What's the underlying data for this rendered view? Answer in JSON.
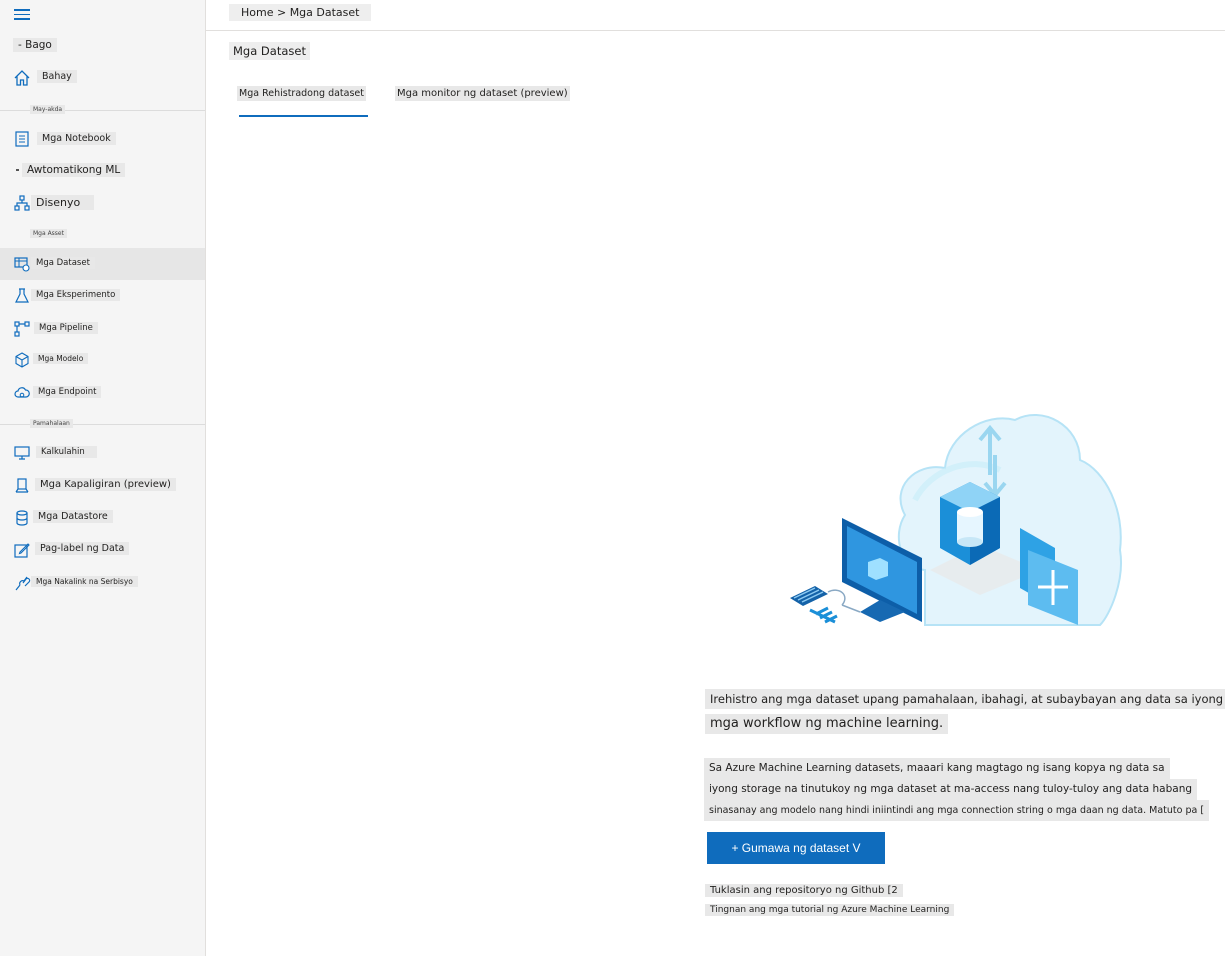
{
  "sidebar": {
    "new_label": "- Bago",
    "home_label": "Bahay",
    "sections": {
      "authoring": "May-akda",
      "assets": "Mga Asset",
      "manage": "Pamahalaan"
    },
    "items": [
      {
        "label": "Mga Notebook",
        "icon": "notebook-icon"
      },
      {
        "label": "Awtomatikong ML",
        "icon": "automl-icon"
      },
      {
        "label": "Disenyo",
        "icon": "designer-icon"
      },
      {
        "label": "Mga Dataset",
        "icon": "dataset-icon"
      },
      {
        "label": "Mga Eksperimento",
        "icon": "flask-icon"
      },
      {
        "label": "Mga Pipeline",
        "icon": "pipeline-icon"
      },
      {
        "label": "Mga Modelo",
        "icon": "cube-icon"
      },
      {
        "label": "Mga Endpoint",
        "icon": "cloud-endpoint-icon"
      },
      {
        "label": "Kalkulahin",
        "icon": "monitor-icon"
      },
      {
        "label": "Mga Kapaligiran (preview)",
        "icon": "environment-icon"
      },
      {
        "label": "Mga Datastore",
        "icon": "database-icon"
      },
      {
        "label": "Pag-label ng Data",
        "icon": "edit-icon"
      },
      {
        "label": "Mga Nakalink na Serbisyo",
        "icon": "link-icon"
      }
    ]
  },
  "header": {
    "breadcrumb": "Home > Mga Dataset",
    "page_title": "Mga Dataset"
  },
  "tabs": [
    {
      "label": "Mga Rehistradong dataset",
      "active": true
    },
    {
      "label": "Mga monitor ng dataset (preview)",
      "active": false
    }
  ],
  "empty_state": {
    "lead_line1": "Irehistro ang mga dataset upang pamahalaan, ibahagi, at subaybayan ang data sa iyong",
    "lead_line2": "mga workflow ng machine learning.",
    "body_line1": "Sa Azure Machine Learning datasets, maaari kang magtago ng isang kopya ng data sa",
    "body_line2": "iyong storage na tinutukoy ng mga dataset at ma-access nang tuloy-tuloy ang data habang",
    "body_line3": "sinasanay ang modelo nang hindi iniintindi ang mga connection string o mga daan ng data. Matuto pa [",
    "create_button": "+ Gumawa ng dataset V",
    "link_github": "Tuklasin ang repositoryo ng Github [2",
    "link_tutorial": "Tingnan ang mga tutorial ng Azure Machine Learning"
  },
  "colors": {
    "accent": "#0f6cbd",
    "sidebar_bg": "#f5f5f5",
    "active_item_bg": "#e6e6e6"
  }
}
